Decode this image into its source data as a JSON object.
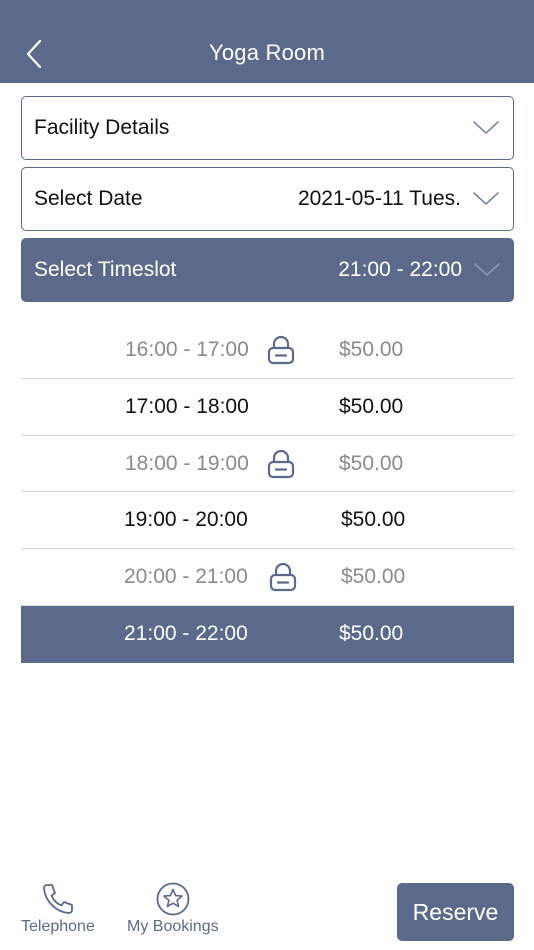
{
  "header": {
    "title": "Yoga Room"
  },
  "facility": {
    "label": "Facility Details"
  },
  "date": {
    "label": "Select Date",
    "value": "2021-05-11 Tues."
  },
  "timeslot": {
    "label": "Select Timeslot",
    "value": "21:00 - 22:00"
  },
  "slots": [
    {
      "time": "16:00 - 17:00",
      "price": "$50.00",
      "state": "locked"
    },
    {
      "time": "17:00 - 18:00",
      "price": "$50.00",
      "state": "available"
    },
    {
      "time": "18:00 - 19:00",
      "price": "$50.00",
      "state": "locked"
    },
    {
      "time": "19:00 - 20:00",
      "price": "$50.00",
      "state": "available"
    },
    {
      "time": "20:00 - 21:00",
      "price": "$50.00",
      "state": "locked"
    },
    {
      "time": "21:00 - 22:00",
      "price": "$50.00",
      "state": "selected"
    }
  ],
  "bottom": {
    "telephone_label": "Telephone",
    "bookings_label": "My Bookings",
    "reserve_label": "Reserve"
  },
  "colors": {
    "accent": "#5b6a8a",
    "locked_text": "#8a8a8a",
    "divider": "#d9d9d9"
  },
  "icons": {
    "back": "chevron-left-icon",
    "dropdown": "chevron-down-icon",
    "locked": "lock-icon",
    "telephone": "phone-icon",
    "bookings": "star-icon"
  }
}
